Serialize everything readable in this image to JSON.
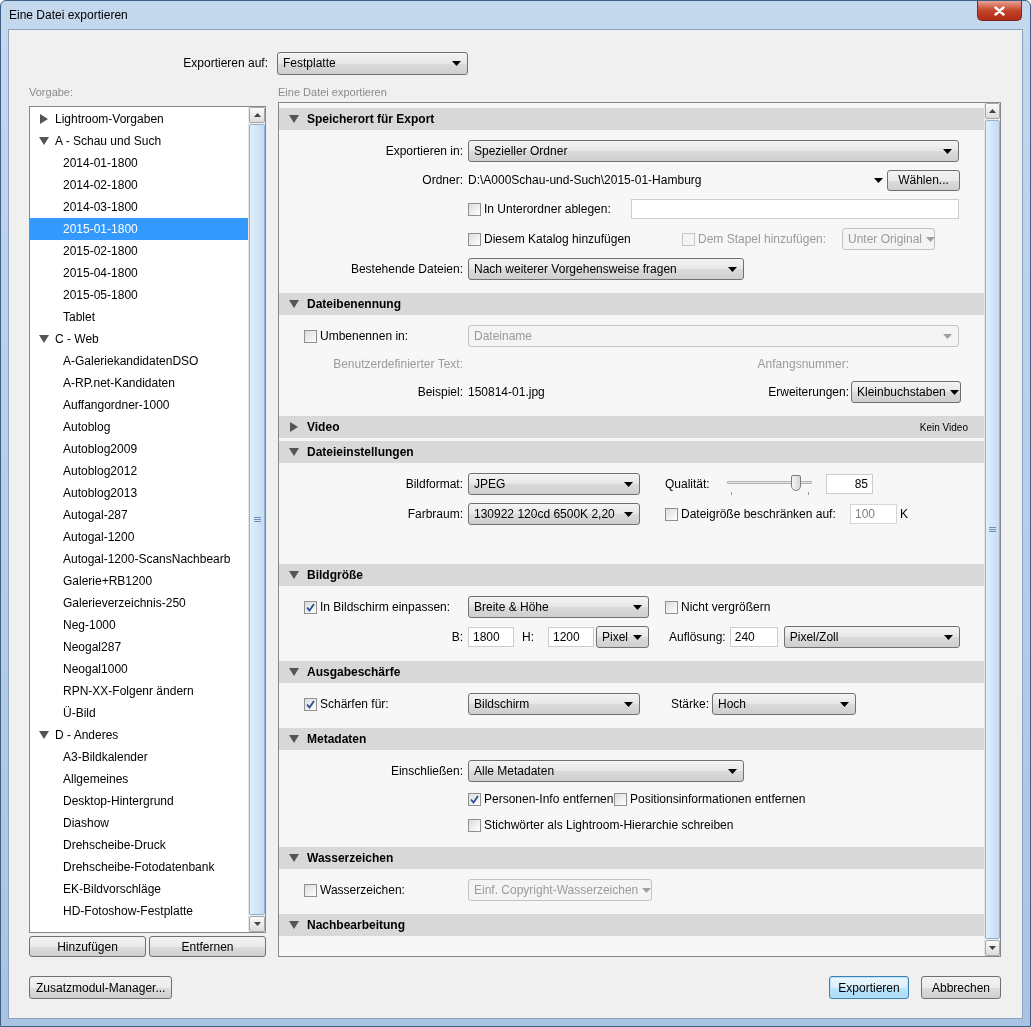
{
  "window": {
    "title": "Eine Datei exportieren"
  },
  "export_to": {
    "label": "Exportieren auf:",
    "value": "Festplatte"
  },
  "presets": {
    "label": "Vorgabe:",
    "items": [
      {
        "label": "Lightroom-Vorgaben",
        "expanded": false,
        "selected": false
      },
      {
        "label": "A - Schau und Such",
        "expanded": true,
        "selected": false,
        "children": [
          {
            "label": "2014-01-1800",
            "selected": false
          },
          {
            "label": "2014-02-1800",
            "selected": false
          },
          {
            "label": "2014-03-1800",
            "selected": false
          },
          {
            "label": "2015-01-1800",
            "selected": true
          },
          {
            "label": "2015-02-1800",
            "selected": false
          },
          {
            "label": "2015-04-1800",
            "selected": false
          },
          {
            "label": "2015-05-1800",
            "selected": false
          },
          {
            "label": "Tablet",
            "selected": false
          }
        ]
      },
      {
        "label": "C - Web",
        "expanded": true,
        "selected": false,
        "children": [
          {
            "label": "A-GaleriekandidatenDSO",
            "selected": false
          },
          {
            "label": "A-RP.net-Kandidaten",
            "selected": false
          },
          {
            "label": "Auffangordner-1000",
            "selected": false
          },
          {
            "label": "Autoblog",
            "selected": false
          },
          {
            "label": "Autoblog2009",
            "selected": false
          },
          {
            "label": "Autoblog2012",
            "selected": false
          },
          {
            "label": "Autoblog2013",
            "selected": false
          },
          {
            "label": "Autogal-287",
            "selected": false
          },
          {
            "label": "Autogal-1200",
            "selected": false
          },
          {
            "label": "Autogal-1200-ScansNachbearb",
            "selected": false
          },
          {
            "label": "Galerie+RB1200",
            "selected": false
          },
          {
            "label": "Galerieverzeichnis-250",
            "selected": false
          },
          {
            "label": "Neg-1000",
            "selected": false
          },
          {
            "label": "Neogal287",
            "selected": false
          },
          {
            "label": "Neogal1000",
            "selected": false
          },
          {
            "label": "RPN-XX-Folgenr ändern",
            "selected": false
          },
          {
            "label": "Ü-Bild",
            "selected": false
          }
        ]
      },
      {
        "label": "D - Anderes",
        "expanded": true,
        "selected": false,
        "children": [
          {
            "label": "A3-Bildkalender",
            "selected": false
          },
          {
            "label": "Allgemeines",
            "selected": false
          },
          {
            "label": "Desktop-Hintergrund",
            "selected": false
          },
          {
            "label": "Diashow",
            "selected": false
          },
          {
            "label": "Drehscheibe-Druck",
            "selected": false
          },
          {
            "label": "Drehscheibe-Fotodatenbank",
            "selected": false
          },
          {
            "label": "EK-Bildvorschläge",
            "selected": false
          },
          {
            "label": "HD-Fotoshow-Festplatte",
            "selected": false
          }
        ]
      }
    ],
    "buttons": [
      "Hinzufügen",
      "Entfernen"
    ]
  },
  "panel": {
    "title": "Eine Datei exportieren",
    "sections": [
      {
        "title": "Speicherort für Export",
        "expanded": true,
        "rows": [
          {
            "items": [
              {
                "kind": "label",
                "text": "Exportieren in:",
                "disabled": false
              },
              {
                "kind": "dropdown",
                "value": "Spezieller Ordner",
                "disabled": false
              }
            ]
          },
          {
            "items": [
              {
                "kind": "label",
                "text": "Ordner:",
                "disabled": false
              },
              {
                "kind": "text",
                "text": "D:\\A000Schau-und-Such\\2015-01-Hamburg",
                "disabled": false
              },
              {
                "kind": "menu_caret"
              },
              {
                "kind": "button",
                "label": "Wählen...",
                "disabled": false
              }
            ]
          },
          {
            "items": [
              {
                "kind": "checkbox",
                "label": "In Unterordner ablegen:",
                "checked": false,
                "disabled": false
              },
              {
                "kind": "field",
                "value": "",
                "disabled": false
              }
            ]
          },
          {
            "items": [
              {
                "kind": "checkbox",
                "label": "Diesem Katalog hinzufügen",
                "checked": false,
                "disabled": false
              },
              {
                "kind": "checkbox",
                "label": "Dem Stapel hinzufügen:",
                "checked": false,
                "disabled": true
              },
              {
                "kind": "dropdown",
                "value": "Unter Original",
                "disabled": true
              }
            ]
          },
          {
            "items": [
              {
                "kind": "label",
                "text": "Bestehende Dateien:",
                "disabled": false
              },
              {
                "kind": "dropdown",
                "value": "Nach weiterer Vorgehensweise fragen",
                "disabled": false
              }
            ]
          }
        ]
      },
      {
        "title": "Dateibenennung",
        "expanded": true,
        "rows": [
          {
            "items": [
              {
                "kind": "checkbox",
                "label": "Umbenennen in:",
                "checked": false,
                "disabled": false
              },
              {
                "kind": "dropdown",
                "value": "Dateiname",
                "disabled": true
              }
            ]
          },
          {
            "items": [
              {
                "kind": "label",
                "text": "Benutzerdefinierter Text:",
                "disabled": true
              },
              {
                "kind": "label",
                "text": "Anfangsnummer:",
                "disabled": true
              }
            ]
          },
          {
            "items": [
              {
                "kind": "label",
                "text": "Beispiel:",
                "disabled": false
              },
              {
                "kind": "text",
                "text": "150814-01.jpg",
                "disabled": false
              },
              {
                "kind": "label",
                "text": "Erweiterungen:",
                "disabled": false
              },
              {
                "kind": "dropdown",
                "value": "Kleinbuchstaben",
                "disabled": false
              }
            ]
          }
        ]
      },
      {
        "title": "Video",
        "expanded": false,
        "note": "Kein Video"
      },
      {
        "title": "Dateieinstellungen",
        "expanded": true,
        "rows": [
          {
            "items": [
              {
                "kind": "label",
                "text": "Bildformat:",
                "disabled": false
              },
              {
                "kind": "dropdown",
                "value": "JPEG",
                "disabled": false
              },
              {
                "kind": "label",
                "text": "Qualität:",
                "disabled": false
              },
              {
                "kind": "slider",
                "level": 0.81
              },
              {
                "kind": "field",
                "value": "85",
                "disabled": false
              }
            ]
          },
          {
            "items": [
              {
                "kind": "label",
                "text": "Farbraum:",
                "disabled": false
              },
              {
                "kind": "dropdown",
                "value": "130922 120cd 6500K 2,20",
                "disabled": false
              },
              {
                "kind": "checkbox",
                "label": "Dateigröße beschränken auf:",
                "checked": false,
                "disabled": false
              },
              {
                "kind": "field",
                "value": "100",
                "disabled": true
              },
              {
                "kind": "text",
                "text": "K",
                "disabled": false
              }
            ]
          }
        ]
      },
      {
        "title": "Bildgröße",
        "expanded": true,
        "rows": [
          {
            "items": [
              {
                "kind": "checkbox",
                "label": "In Bildschirm einpassen:",
                "checked": true,
                "disabled": false
              },
              {
                "kind": "dropdown",
                "value": "Breite & Höhe",
                "disabled": false
              },
              {
                "kind": "checkbox",
                "label": "Nicht vergrößern",
                "checked": false,
                "disabled": false
              }
            ]
          },
          {
            "items": [
              {
                "kind": "label",
                "text": "B:",
                "disabled": false
              },
              {
                "kind": "field",
                "value": "1800",
                "disabled": false
              },
              {
                "kind": "label",
                "text": "H:",
                "disabled": false
              },
              {
                "kind": "field",
                "value": "1200",
                "disabled": false
              },
              {
                "kind": "dropdown",
                "value": "Pixel",
                "disabled": false
              },
              {
                "kind": "label",
                "text": "Auflösung:",
                "disabled": false
              },
              {
                "kind": "field",
                "value": "240",
                "disabled": false
              },
              {
                "kind": "dropdown",
                "value": "Pixel/Zoll",
                "disabled": false
              }
            ]
          }
        ]
      },
      {
        "title": "Ausgabeschärfe",
        "expanded": true,
        "rows": [
          {
            "items": [
              {
                "kind": "checkbox",
                "label": "Schärfen für:",
                "checked": true,
                "disabled": false
              },
              {
                "kind": "dropdown",
                "value": "Bildschirm",
                "disabled": false
              },
              {
                "kind": "label",
                "text": "Stärke:",
                "disabled": false
              },
              {
                "kind": "dropdown",
                "value": "Hoch",
                "disabled": false
              }
            ]
          }
        ]
      },
      {
        "title": "Metadaten",
        "expanded": true,
        "rows": [
          {
            "items": [
              {
                "kind": "label",
                "text": "Einschließen:",
                "disabled": false
              },
              {
                "kind": "dropdown",
                "value": "Alle Metadaten",
                "disabled": false
              }
            ]
          },
          {
            "items": [
              {
                "kind": "checkbox",
                "label": "Personen-Info entfernen",
                "checked": true,
                "disabled": false
              },
              {
                "kind": "checkbox",
                "label": "Positionsinformationen entfernen",
                "checked": false,
                "disabled": false
              }
            ]
          },
          {
            "items": [
              {
                "kind": "checkbox",
                "label": "Stichwörter als Lightroom-Hierarchie schreiben",
                "checked": false,
                "disabled": false
              }
            ]
          }
        ]
      },
      {
        "title": "Wasserzeichen",
        "expanded": true,
        "rows": [
          {
            "items": [
              {
                "kind": "checkbox",
                "label": "Wasserzeichen:",
                "checked": false,
                "disabled": false
              },
              {
                "kind": "dropdown",
                "value": "Einf. Copyright-Wasserzeichen",
                "disabled": true
              }
            ]
          }
        ]
      },
      {
        "title": "Nachbearbeitung",
        "expanded": true
      }
    ]
  },
  "footer": {
    "manager_button": "Zusatzmodul-Manager...",
    "buttons": [
      {
        "label": "Exportieren",
        "default": true
      },
      {
        "label": "Abbrechen",
        "default": false
      }
    ]
  }
}
